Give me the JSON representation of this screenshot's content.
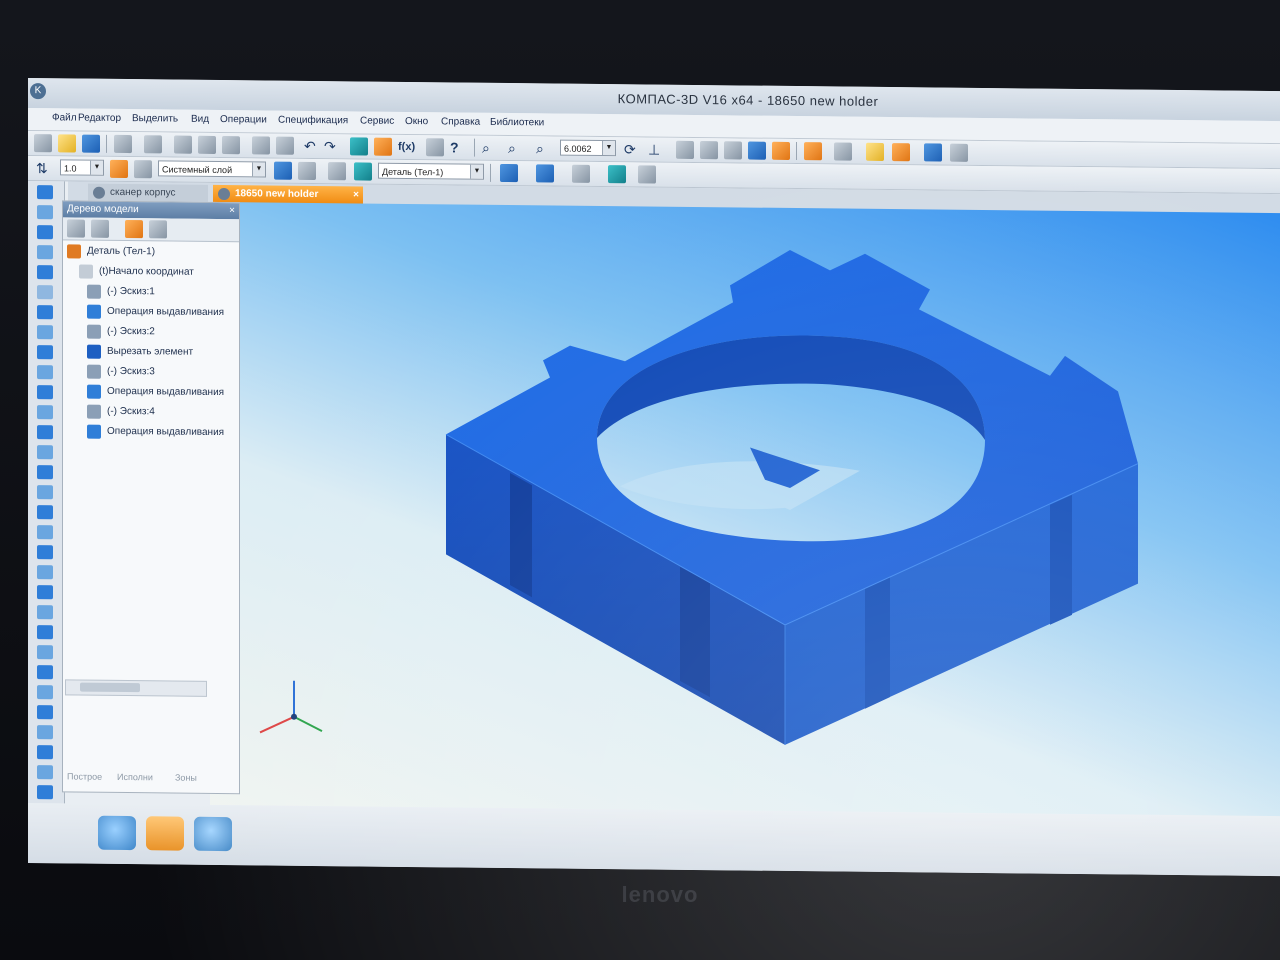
{
  "window": {
    "title": "КОМПАС-3D V16  x64 - 18650 new holder"
  },
  "menu": [
    "Файл",
    "Редактор",
    "Выделить",
    "Вид",
    "Операции",
    "Спецификация",
    "Сервис",
    "Окно",
    "Справка",
    "Библиотеки"
  ],
  "toolbar": {
    "zoom_value": "6.0062",
    "fx_label": "f(x)",
    "scale_value": "1.0",
    "layer_value": "Системный слой",
    "part_value": "Деталь (Тел-1)"
  },
  "tabs": [
    {
      "label": "сканер корпус",
      "active": false
    },
    {
      "label": "18650 new holder",
      "active": true
    }
  ],
  "tree": {
    "title": "Дерево модели",
    "items": [
      {
        "label": "Деталь (Тел-1)",
        "icon": "part-icon"
      },
      {
        "label": "(t)Начало координат",
        "icon": "origin-icon"
      },
      {
        "label": "(-) Эскиз:1",
        "icon": "sketch-icon"
      },
      {
        "label": "Операция выдавливания",
        "icon": "extrude-icon"
      },
      {
        "label": "(-) Эскиз:2",
        "icon": "sketch-icon"
      },
      {
        "label": "Вырезать элемент",
        "icon": "cut-icon"
      },
      {
        "label": "(-) Эскиз:3",
        "icon": "sketch-icon"
      },
      {
        "label": "Операция выдавливания",
        "icon": "extrude-icon"
      },
      {
        "label": "(-) Эскиз:4",
        "icon": "sketch-icon"
      },
      {
        "label": "Операция выдавливания",
        "icon": "extrude-icon"
      }
    ],
    "bottom_tabs": [
      "Построе",
      "Исполни",
      "Зоны"
    ]
  },
  "colors": {
    "model": "#1665e0",
    "accent": "#f08a10"
  }
}
